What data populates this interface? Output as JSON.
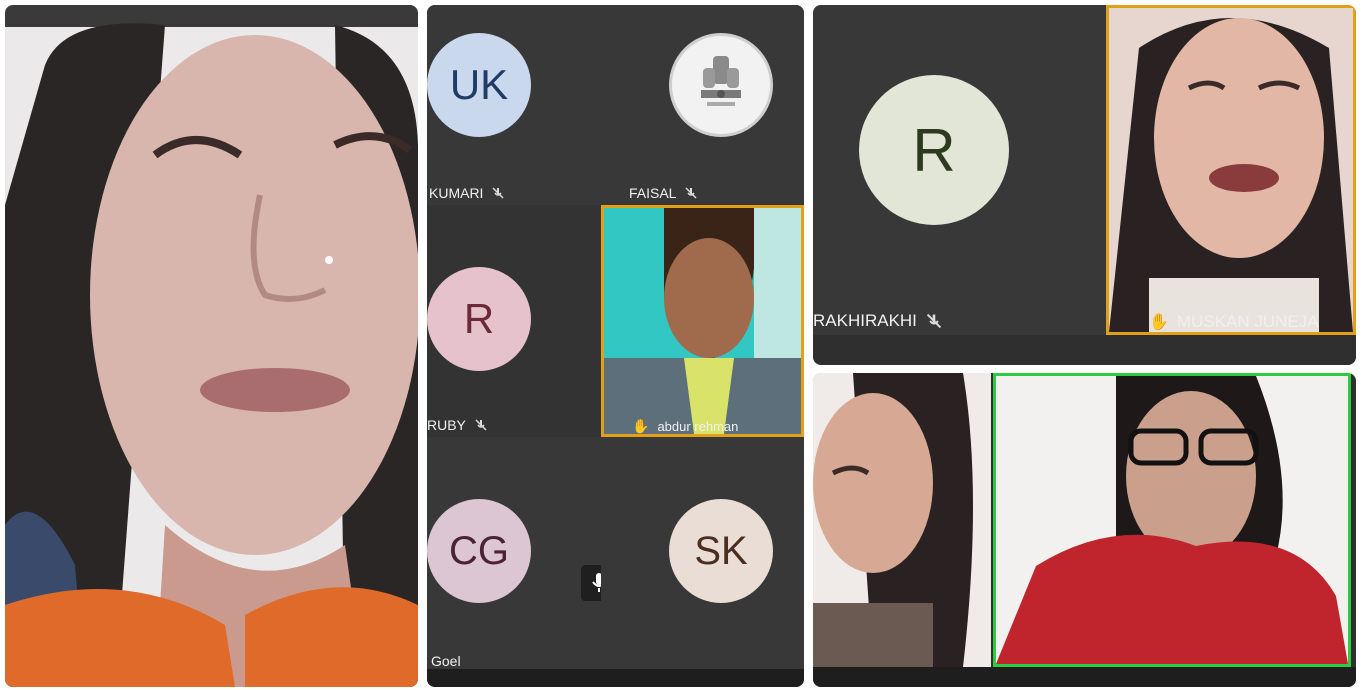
{
  "left_panel": {
    "participant": "video-feed-woman"
  },
  "middle_panel": {
    "tiles": [
      {
        "initials": "UK",
        "name": "KUMARI",
        "avatar_bg": "#c9d8ec",
        "text_color": "#1f3b66"
      },
      {
        "name": "FAISAL",
        "logo": "emblem-logo"
      },
      {
        "initials": "R",
        "name": "RUBY",
        "avatar_bg": "#e6c3cc",
        "text_color": "#6a2a3a"
      },
      {
        "name": "abdur rehman",
        "video": true
      },
      {
        "initials": "CG",
        "name": "Goel",
        "avatar_bg": "#dcc6d3",
        "text_color": "#4b2236"
      },
      {
        "initials": "SK",
        "name": "",
        "avatar_bg": "#e9ddd5",
        "text_color": "#4a2e22"
      }
    ],
    "mic_icon": "microphone-icon"
  },
  "top_right_panel": {
    "tiles": [
      {
        "initials": "R",
        "name": "RAKHIRAKHI",
        "avatar_bg": "#e2e6d6",
        "text_color": "#2c3a20"
      },
      {
        "name": "MUSKAN JUNEJA",
        "video": true
      }
    ]
  },
  "bottom_right_panel": {
    "tiles": [
      {
        "name": "",
        "video": true
      },
      {
        "name": "",
        "video": true,
        "active": true
      }
    ]
  },
  "colors": {
    "speaker_border_orange": "#e0a018",
    "speaker_border_green": "#2ecc40"
  }
}
